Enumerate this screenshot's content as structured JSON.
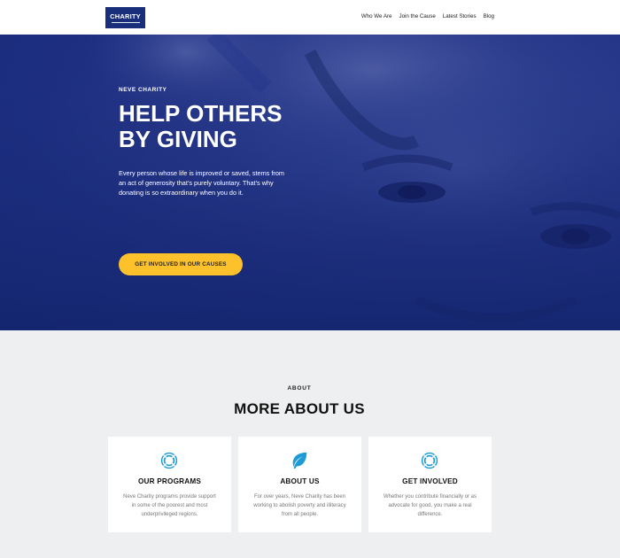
{
  "header": {
    "logo_text": "CHARITY",
    "nav": [
      "Who We Are",
      "Join the Cause",
      "Latest Stories",
      "Blog"
    ]
  },
  "hero": {
    "eyebrow": "NEVE CHARITY",
    "title": "HELP OTHERS BY GIVING",
    "text": "Every person whose life is improved or saved, stems from an act of generosity that’s purely voluntary. That’s why donating is so extraordinary when you do it.",
    "cta_label": "GET INVOLVED IN OUR CAUSES"
  },
  "about": {
    "eyebrow": "ABOUT",
    "title": "MORE ABOUT US",
    "cards": [
      {
        "icon": "lifebuoy-icon",
        "title": "OUR PROGRAMS",
        "text": "Neve Charity programs provide support in some of the poorest and most underprivileged regions."
      },
      {
        "icon": "leaf-icon",
        "title": "ABOUT US",
        "text": "For over years, Neve Charity has been working to abolish poverty and illiteracy from all people."
      },
      {
        "icon": "lifebuoy-icon",
        "title": "GET INVOLVED",
        "text": "Whether you contribute financially or as advocate for good, you make a real difference."
      }
    ]
  },
  "colors": {
    "brand_navy": "#1a2f7c",
    "hero_overlay": "#1e2f82",
    "cta_yellow": "#fdc22b",
    "icon_blue": "#1e9ad6",
    "section_bg": "#eeeff1"
  }
}
